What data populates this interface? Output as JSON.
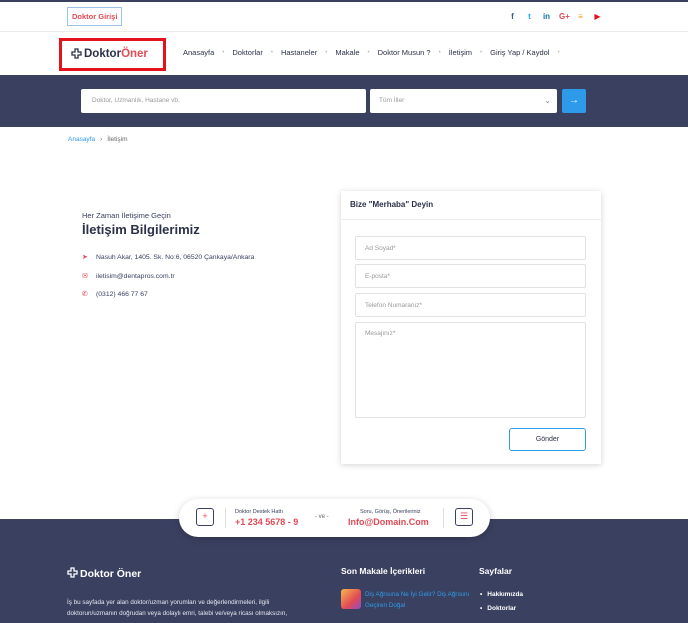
{
  "topbar": {
    "doktor_girisi": "Doktor Girişi",
    "socials": [
      {
        "icon": "facebook-icon",
        "glyph": "f",
        "color": "#3b5998"
      },
      {
        "icon": "twitter-icon",
        "glyph": "t",
        "color": "#1da1f2"
      },
      {
        "icon": "linkedin-icon",
        "glyph": "in",
        "color": "#0e76a8"
      },
      {
        "icon": "google-plus-icon",
        "glyph": "G+",
        "color": "#e24a55"
      },
      {
        "icon": "rss-icon",
        "glyph": "≡",
        "color": "#f39c12"
      },
      {
        "icon": "youtube-icon",
        "glyph": "▶",
        "color": "#e3121b"
      }
    ]
  },
  "header": {
    "logo_part1": "Doktor",
    "logo_part2": "Öner",
    "nav": [
      "Anasayfa",
      "Doktorlar",
      "Hastaneler",
      "Makale",
      "Doktor Musun ?",
      "İletişim",
      "Giriş Yap / Kaydol"
    ]
  },
  "search": {
    "placeholder": "Doktor, Uzmanlık, Hastane vb.",
    "city_select": "Tüm İller"
  },
  "breadcrumb": {
    "home": "Anasayfa",
    "current": "İletişim"
  },
  "contact": {
    "eyebrow": "Her Zaman İletişime Geçin",
    "title": "İletişim Bilgilerimiz",
    "address": "Nasuh Akar, 1405. Sk. No:6, 06520 Çankaya/Ankara",
    "email": "iletisim@dentapros.com.tr",
    "phone": "(0312) 466 77 67"
  },
  "form": {
    "heading": "Bize \"Merhaba\" Deyin",
    "name_placeholder": "Ad Soyad*",
    "email_placeholder": "E-posta*",
    "phone_placeholder": "Telefon Numaranız*",
    "message_placeholder": "Mesajınız*",
    "submit": "Gönder"
  },
  "support": {
    "hotline_label": "Doktor Destek Hattı",
    "hotline": "+1 234 5678 - 9",
    "ve": "- ve -",
    "mail_label": "Soru, Görüş, Önerileriniz",
    "mail": "Info@Domain.Com"
  },
  "footer": {
    "logo": "Doktor Öner",
    "about": "İş bu sayfada yer alan doktor/uzman yorumları ve değerlendirmeleri, ilgili doktorun/uzmanın doğrudan veya dolaylı emri, talebi ve/veya ricası olmaksızın,",
    "articles_heading": "Son Makale İçerikleri",
    "article_title": "Diş Ağrısına Ne İyi Gelir? Diş Ağrısını Geçiren Doğal",
    "pages_heading": "Sayfalar",
    "pages": [
      "Hakkımızda",
      "Doktorlar"
    ]
  }
}
